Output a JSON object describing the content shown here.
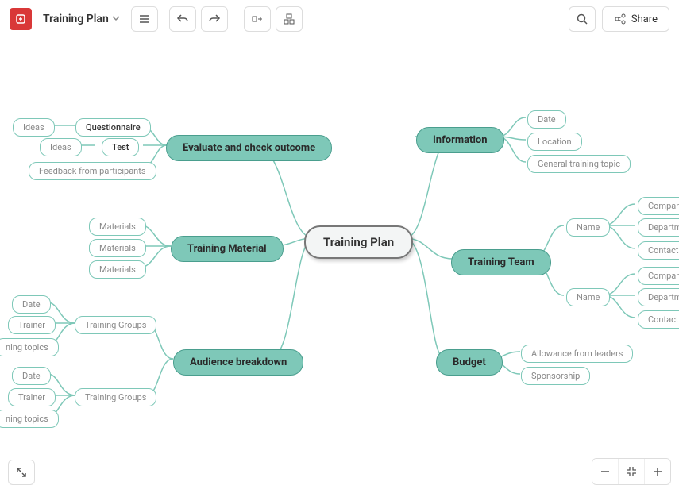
{
  "toolbar": {
    "doc_title": "Training Plan",
    "share_label": "Share"
  },
  "root": {
    "label": "Training Plan"
  },
  "mains": {
    "evaluate": "Evaluate and check outcome",
    "material": "Training Material",
    "audience": "Audience breakdown",
    "information": "Information",
    "team": "Training Team",
    "budget": "Budget"
  },
  "subs": {
    "questionnaire": "Questionnaire",
    "test": "Test",
    "feedback": "Feedback from participants",
    "ideas1": "Ideas",
    "ideas2": "Ideas",
    "materials1": "Materials",
    "materials2": "Materials",
    "materials3": "Materials",
    "tg1": "Training Groups",
    "tg2": "Training Groups",
    "date1": "Date",
    "trainer1": "Trainer",
    "topics1": "ning topics",
    "date2_": "Date",
    "trainer2": "Trainer",
    "topics2": "ning topics",
    "info_date": "Date",
    "info_loc": "Location",
    "info_topic": "General training topic",
    "name1": "Name",
    "name2": "Name",
    "company1": "Company",
    "dept1": "Departmen",
    "cinfo1": "Contact inf",
    "company2": "Company",
    "dept2": "Departmen",
    "cinfo2": "Contact inf",
    "allowance": "Allowance from leaders",
    "sponsor": "Sponsorship"
  }
}
